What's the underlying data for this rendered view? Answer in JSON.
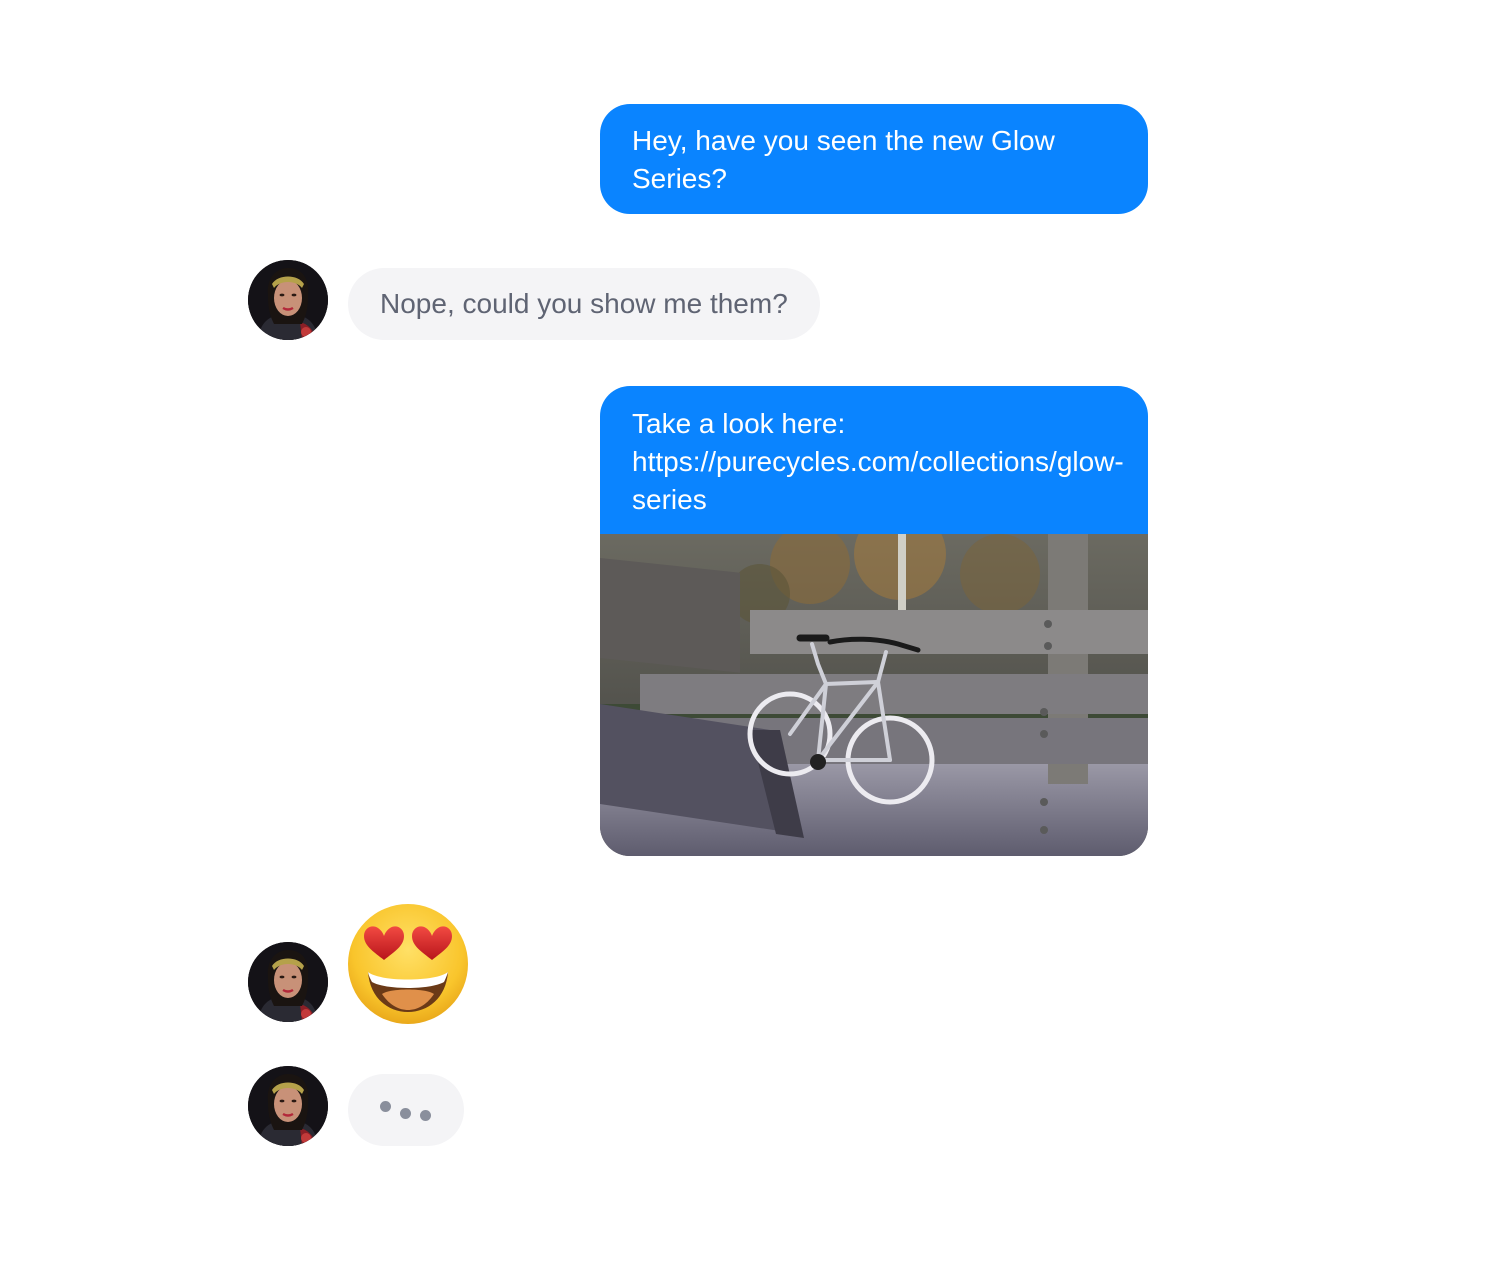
{
  "conversation": {
    "messages": [
      {
        "sender": "me",
        "text": "Hey, have you seen the new Glow Series?"
      },
      {
        "sender": "contact",
        "text": "Nope, could you show me them?"
      },
      {
        "sender": "me",
        "text": "Take a look here: https://purecycles.com/collections/glow-series",
        "attachment": "bicycle-photo"
      },
      {
        "sender": "contact",
        "emoji": "heart-eyes-emoji"
      },
      {
        "sender": "contact",
        "typing_indicator": "typing-dots-icon"
      }
    ]
  },
  "colors": {
    "outgoing_bubble": "#0a84ff",
    "incoming_bubble": "#f4f4f6",
    "incoming_text": "#5f6473",
    "background": "#ffffff"
  },
  "icons": [
    "avatar",
    "heart-eyes-emoji",
    "typing-dots-icon"
  ]
}
